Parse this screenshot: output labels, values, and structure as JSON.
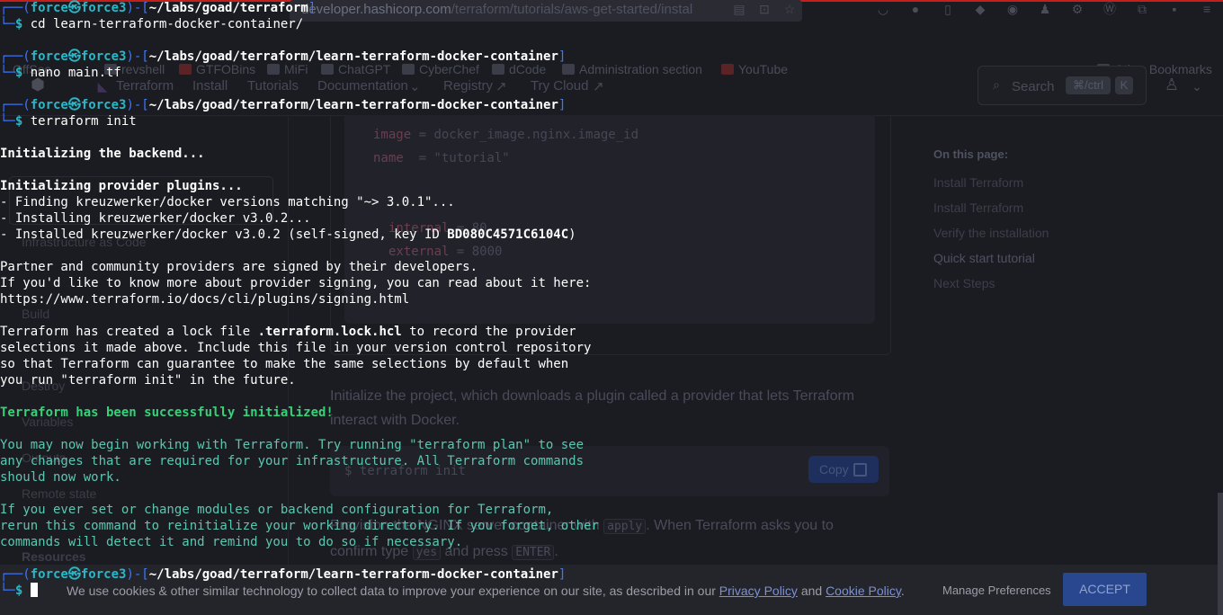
{
  "browser": {
    "url_host": "developer.hashicorp.com",
    "url_path": "/terraform/tutorials/aws-get-started/instal",
    "bookmarks": [
      "OffSec",
      "revshell",
      "GTFOBins",
      "MiFi",
      "ChatGPT",
      "CyberChef",
      "dCode",
      "Administration section",
      "YouTube"
    ],
    "other_bookmarks": "Other Bookmarks"
  },
  "site": {
    "nav": [
      "Terraform",
      "Install",
      "Tutorials",
      "Documentation",
      "Registry",
      "Try Cloud"
    ],
    "search_label": "Search",
    "search_kbd": "⌘/ctrl",
    "search_key": "K"
  },
  "sidebar": {
    "items": [
      "Infrastructure as Code",
      "Build",
      "Destroy",
      "Variables",
      "Outputs",
      "Remote state",
      "Resources"
    ]
  },
  "main": {
    "code_lines": [
      {
        "key": "image",
        "rest": " = docker_image.nginx.image_id"
      },
      {
        "key": "name",
        "rest": "  = \"tutorial\""
      },
      {
        "key": "internal",
        "rest": " = 80"
      },
      {
        "key": "external",
        "rest": " = 8000"
      }
    ],
    "para1": "Initialize the project, which downloads a plugin called a provider that lets Terraform interact with Docker.",
    "command": "$ terraform init",
    "copy_label": "Copy",
    "para2_a": "Provision the NGINX server container with",
    "para2_code": "apply",
    "para2_b": ". When Terraform asks you to confirm type",
    "para2_code2": "yes",
    "para2_c": "and press",
    "para2_code3": "ENTER",
    "para2_d": "."
  },
  "toc": {
    "title": "On this page:",
    "items": [
      "Install Terraform",
      "Install Terraform",
      "Verify the installation",
      "Quick start tutorial",
      "Next Steps"
    ]
  },
  "cookie": {
    "text": "We use cookies & other similar technology to collect data to improve your experience on our site, as described in our",
    "privacy": "Privacy Policy",
    "and": "and",
    "cookie_policy": "Cookie Policy",
    "period": ".",
    "manage": "Manage Preferences",
    "accept": "ACCEPT"
  },
  "terminal": {
    "user": "force",
    "host": "force3",
    "prompts": [
      {
        "path": "~/labs/goad/terraform",
        "cmd": "cd learn-terraform-docker-container/"
      },
      {
        "path": "~/labs/goad/terraform/learn-terraform-docker-container",
        "cmd": "nano main.tf"
      },
      {
        "path": "~/labs/goad/terraform/learn-terraform-docker-container",
        "cmd": "terraform init"
      },
      {
        "path": "~/labs/goad/terraform/learn-terraform-docker-container",
        "cmd": ""
      }
    ],
    "output": {
      "backend": "Initializing the backend...",
      "plugins": "Initializing provider plugins...",
      "find": "- Finding kreuzwerker/docker versions matching \"~> 3.0.1\"...",
      "installing": "- Installing kreuzwerker/docker v3.0.2...",
      "installed_a": "- Installed kreuzwerker/docker v3.0.2 (self-signed, key ID ",
      "installed_key": "BD080C4571C6104C",
      "installed_b": ")",
      "partner1": "Partner and community providers are signed by their developers.",
      "partner2": "If you'd like to know more about provider signing, you can read about it here:",
      "partner3": "https://www.terraform.io/docs/cli/plugins/signing.html",
      "lock1_a": "Terraform has created a lock file ",
      "lock1_file": ".terraform.lock.hcl",
      "lock1_b": " to record the provider",
      "lock2": "selections it made above. Include this file in your version control repository",
      "lock3": "so that Terraform can guarantee to make the same selections by default when",
      "lock4": "you run \"terraform init\" in the future.",
      "success": "Terraform has been successfully initialized!",
      "may1": "You may now begin working with Terraform. Try running \"terraform plan\" to see",
      "may2": "any changes that are required for your infrastructure. All Terraform commands",
      "may3": "should now work.",
      "ever1": "If you ever set or change modules or backend configuration for Terraform,",
      "ever2": "rerun this command to reinitialize your working directory. If you forget, other",
      "ever3": "commands will detect it and remind you to do so if necessary."
    }
  }
}
